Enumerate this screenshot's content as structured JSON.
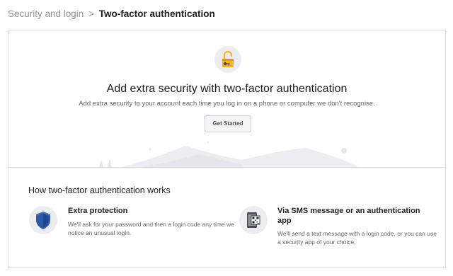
{
  "breadcrumb": {
    "parent": "Security and login",
    "separator": ">",
    "current": "Two-factor authentication"
  },
  "hero": {
    "icon": "unlocked-padlock-icon",
    "title": "Add extra security with two-factor authentication",
    "subtitle": "Add extra security to your account each time you log in on a phone or computer we don't recognise.",
    "button_label": "Get Started"
  },
  "how_it_works": {
    "title": "How two-factor authentication works",
    "features": [
      {
        "icon": "shield-icon",
        "title": "Extra protection",
        "description": "We'll ask for your password and then a login code any time we notice an unusual login."
      },
      {
        "icon": "phone-qr-icon",
        "title": "Via SMS message or an authentication app",
        "description": "We'll send a text message with a login code, or you can use a security app of your choice."
      }
    ]
  },
  "colors": {
    "lock_gold": "#f5b42a",
    "shield_blue": "#2d5aa7",
    "text_secondary": "#606770",
    "border": "#dddfe2"
  }
}
